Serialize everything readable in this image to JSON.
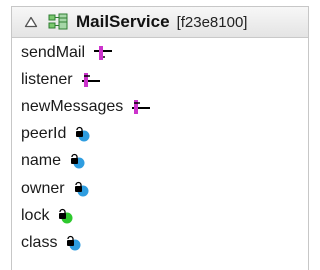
{
  "header": {
    "class_name": "MailService",
    "instance_id": "[f23e8100]",
    "collapse_icon": "triangle-up-icon",
    "class_icon": "class-structure-icon"
  },
  "members": [
    {
      "label": "sendMail",
      "icon": "method-icon",
      "icon_color": "#cc33cc"
    },
    {
      "label": "listener",
      "icon": "method-icon",
      "icon_color": "#cc33cc"
    },
    {
      "label": "newMessages",
      "icon": "method-icon",
      "icon_color": "#cc33cc"
    },
    {
      "label": "peerId",
      "icon": "private-field-icon",
      "icon_color": "#2f9de0"
    },
    {
      "label": "name",
      "icon": "private-field-icon",
      "icon_color": "#2f9de0"
    },
    {
      "label": "owner",
      "icon": "private-field-icon",
      "icon_color": "#2f9de0"
    },
    {
      "label": "lock",
      "icon": "private-field-icon",
      "icon_color": "#2ec92e"
    },
    {
      "label": "class",
      "icon": "private-field-icon",
      "icon_color": "#2f9de0"
    }
  ]
}
